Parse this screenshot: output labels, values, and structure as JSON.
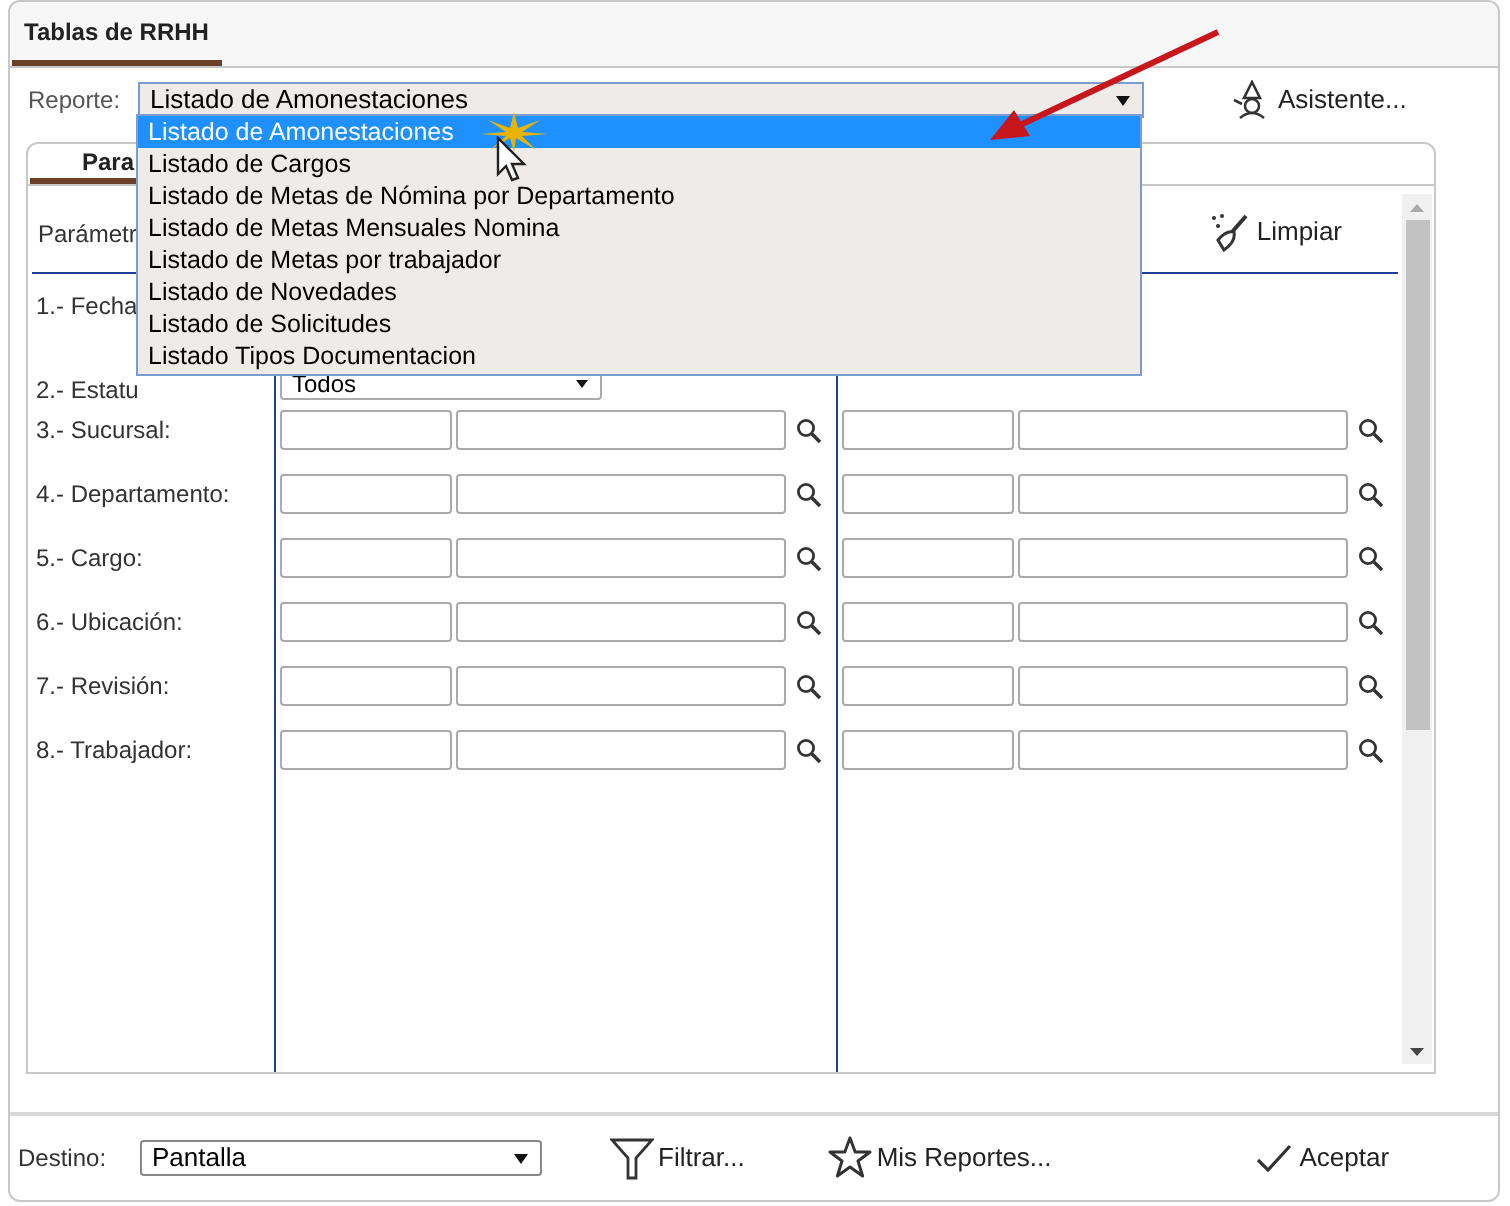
{
  "window": {
    "tab": "Tablas de RRHH"
  },
  "report": {
    "label": "Reporte:",
    "value": "Listado de Amonestaciones",
    "expanded": true,
    "options": [
      {
        "label": "Listado de Amonestaciones",
        "selected": true
      },
      {
        "label": "Listado de Cargos",
        "selected": false
      },
      {
        "label": "Listado de Metas de Nómina por Departamento",
        "selected": false
      },
      {
        "label": "Listado de Metas Mensuales Nomina",
        "selected": false
      },
      {
        "label": "Listado de Metas por trabajador",
        "selected": false
      },
      {
        "label": "Listado de Novedades",
        "selected": false
      },
      {
        "label": "Listado de Solicitudes",
        "selected": false
      },
      {
        "label": "Listado Tipos Documentacion",
        "selected": false
      }
    ]
  },
  "wizard_button": "Asistente...",
  "panel": {
    "tab": "Para",
    "heading": "Parámetr",
    "clear_button": "Limpiar",
    "fields": [
      {
        "label": "1.- Fecha",
        "kind": "date"
      },
      {
        "label": "2.- Estatu",
        "kind": "select",
        "value": "Todos"
      },
      {
        "label": "3.- Sucursal:",
        "kind": "range"
      },
      {
        "label": "4.- Departamento:",
        "kind": "range"
      },
      {
        "label": "5.- Cargo:",
        "kind": "range"
      },
      {
        "label": "6.- Ubicación:",
        "kind": "range"
      },
      {
        "label": "7.- Revisión:",
        "kind": "range"
      },
      {
        "label": "8.- Trabajador:",
        "kind": "range"
      }
    ]
  },
  "footer": {
    "destination_label": "Destino:",
    "destination": "Pantalla",
    "filter_button": "Filtrar...",
    "my_reports_button": "Mis Reportes...",
    "accept_button": "Aceptar"
  }
}
